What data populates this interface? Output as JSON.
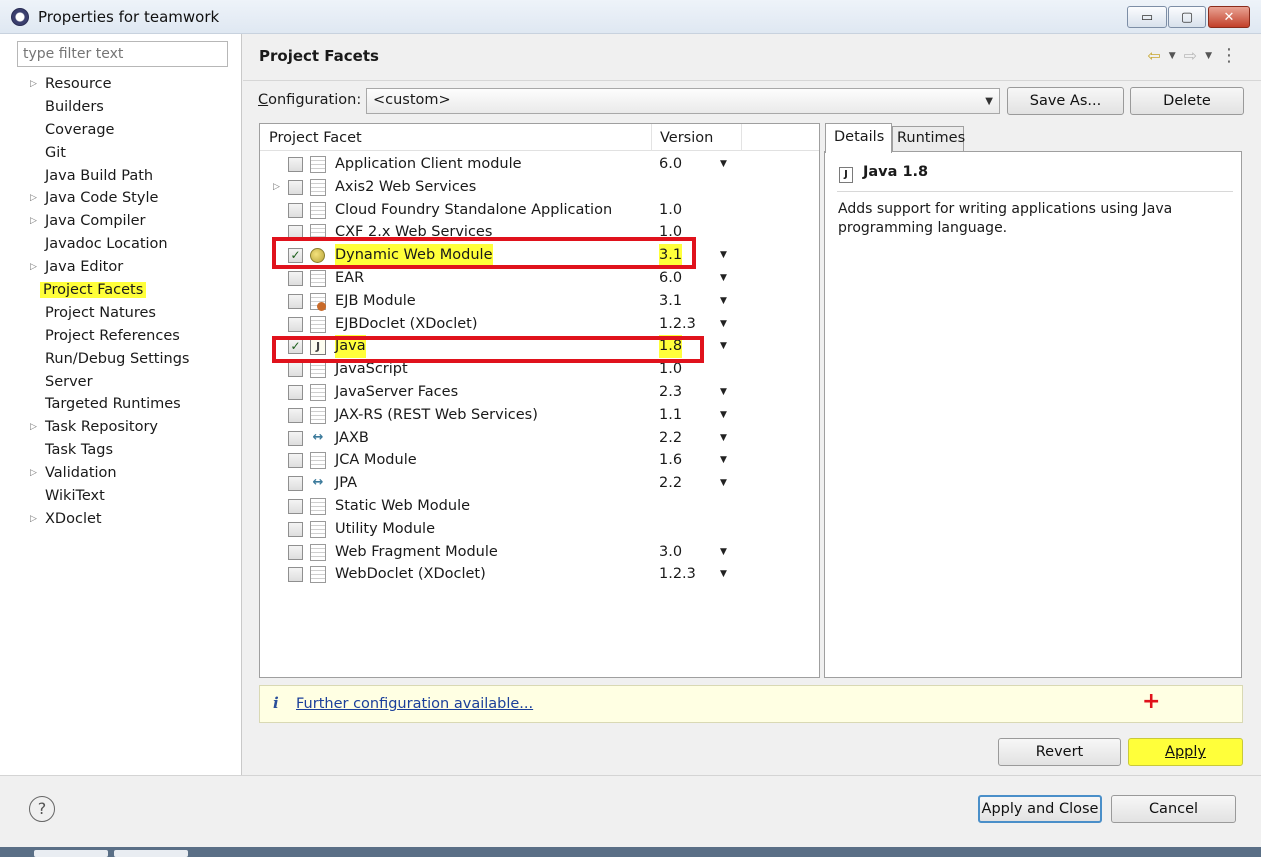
{
  "window": {
    "title": "Properties for teamwork",
    "min_glyph": "▭",
    "max_glyph": "▢",
    "close_glyph": "✕"
  },
  "sidebar": {
    "filter_placeholder": "type filter text",
    "items": [
      {
        "label": "Resource",
        "expandable": true
      },
      {
        "label": "Builders",
        "expandable": false
      },
      {
        "label": "Coverage",
        "expandable": false
      },
      {
        "label": "Git",
        "expandable": false
      },
      {
        "label": "Java Build Path",
        "expandable": false
      },
      {
        "label": "Java Code Style",
        "expandable": true
      },
      {
        "label": "Java Compiler",
        "expandable": true
      },
      {
        "label": "Javadoc Location",
        "expandable": false
      },
      {
        "label": "Java Editor",
        "expandable": true
      },
      {
        "label": "Project Facets",
        "expandable": false,
        "selected": true
      },
      {
        "label": "Project Natures",
        "expandable": false
      },
      {
        "label": "Project References",
        "expandable": false
      },
      {
        "label": "Run/Debug Settings",
        "expandable": false
      },
      {
        "label": "Server",
        "expandable": false
      },
      {
        "label": "Targeted Runtimes",
        "expandable": false
      },
      {
        "label": "Task Repository",
        "expandable": true
      },
      {
        "label": "Task Tags",
        "expandable": false
      },
      {
        "label": "Validation",
        "expandable": true
      },
      {
        "label": "WikiText",
        "expandable": false
      },
      {
        "label": "XDoclet",
        "expandable": true
      }
    ]
  },
  "page": {
    "title": "Project Facets",
    "nav": {
      "back_glyph": "⇦",
      "fwd_glyph": "⇨",
      "drop_glyph": "▼",
      "menu_glyph": "⋮"
    }
  },
  "configuration": {
    "label_prefix": "C",
    "label_rest": "onfiguration:",
    "value": "<custom>",
    "save_as_label": "Save As...",
    "delete_label": "Delete"
  },
  "facets": {
    "col_facet": "Project Facet",
    "col_version": "Version",
    "rows": [
      {
        "name": "Application Client module",
        "version": "6.0",
        "checked": false,
        "dropdown": true,
        "icon": "doc",
        "expander": false
      },
      {
        "name": "Axis2 Web Services",
        "version": "",
        "checked": false,
        "dropdown": false,
        "icon": "doc",
        "expander": true
      },
      {
        "name": "Cloud Foundry Standalone Application",
        "version": "1.0",
        "checked": false,
        "dropdown": false,
        "icon": "doc",
        "expander": false
      },
      {
        "name": "CXF 2.x Web Services",
        "version": "1.0",
        "checked": false,
        "dropdown": false,
        "icon": "doc",
        "expander": false
      },
      {
        "name": "Dynamic Web Module",
        "version": "3.1",
        "checked": true,
        "dropdown": true,
        "icon": "web",
        "expander": false,
        "highlighted": true
      },
      {
        "name": "EAR",
        "version": "6.0",
        "checked": false,
        "dropdown": true,
        "icon": "doc",
        "expander": false
      },
      {
        "name": "EJB Module",
        "version": "3.1",
        "checked": false,
        "dropdown": true,
        "icon": "ejb",
        "expander": false
      },
      {
        "name": "EJBDoclet (XDoclet)",
        "version": "1.2.3",
        "checked": false,
        "dropdown": true,
        "icon": "doc",
        "expander": false
      },
      {
        "name": "Java",
        "version": "1.8",
        "checked": true,
        "dropdown": true,
        "icon": "java",
        "expander": false,
        "highlighted": true
      },
      {
        "name": "JavaScript",
        "version": "1.0",
        "checked": false,
        "dropdown": false,
        "icon": "doc",
        "expander": false
      },
      {
        "name": "JavaServer Faces",
        "version": "2.3",
        "checked": false,
        "dropdown": true,
        "icon": "doc",
        "expander": false
      },
      {
        "name": "JAX-RS (REST Web Services)",
        "version": "1.1",
        "checked": false,
        "dropdown": true,
        "icon": "doc",
        "expander": false
      },
      {
        "name": "JAXB",
        "version": "2.2",
        "checked": false,
        "dropdown": true,
        "icon": "xml",
        "expander": false
      },
      {
        "name": "JCA Module",
        "version": "1.6",
        "checked": false,
        "dropdown": true,
        "icon": "doc",
        "expander": false
      },
      {
        "name": "JPA",
        "version": "2.2",
        "checked": false,
        "dropdown": true,
        "icon": "xml",
        "expander": false
      },
      {
        "name": "Static Web Module",
        "version": "",
        "checked": false,
        "dropdown": false,
        "icon": "doc",
        "expander": false
      },
      {
        "name": "Utility Module",
        "version": "",
        "checked": false,
        "dropdown": false,
        "icon": "doc",
        "expander": false
      },
      {
        "name": "Web Fragment Module",
        "version": "3.0",
        "checked": false,
        "dropdown": true,
        "icon": "doc",
        "expander": false
      },
      {
        "name": "WebDoclet (XDoclet)",
        "version": "1.2.3",
        "checked": false,
        "dropdown": true,
        "icon": "doc",
        "expander": false
      }
    ]
  },
  "details": {
    "tab_details": "Details",
    "tab_runtimes": "Runtimes",
    "icon_glyph": "J",
    "title": "Java 1.8",
    "description": "Adds support for writing applications using Java programming language."
  },
  "info": {
    "icon_glyph": "i",
    "link": "Further configuration available...",
    "cursor_glyph": "+"
  },
  "actions": {
    "revert_label": "Revert",
    "apply_label": "Apply",
    "apply_close_label": "Apply and Close",
    "cancel_label": "Cancel",
    "help_glyph": "?"
  },
  "colors": {
    "highlight": "#ffff3a",
    "annotation_red": "#e0121c",
    "link": "#1b3f9a"
  }
}
